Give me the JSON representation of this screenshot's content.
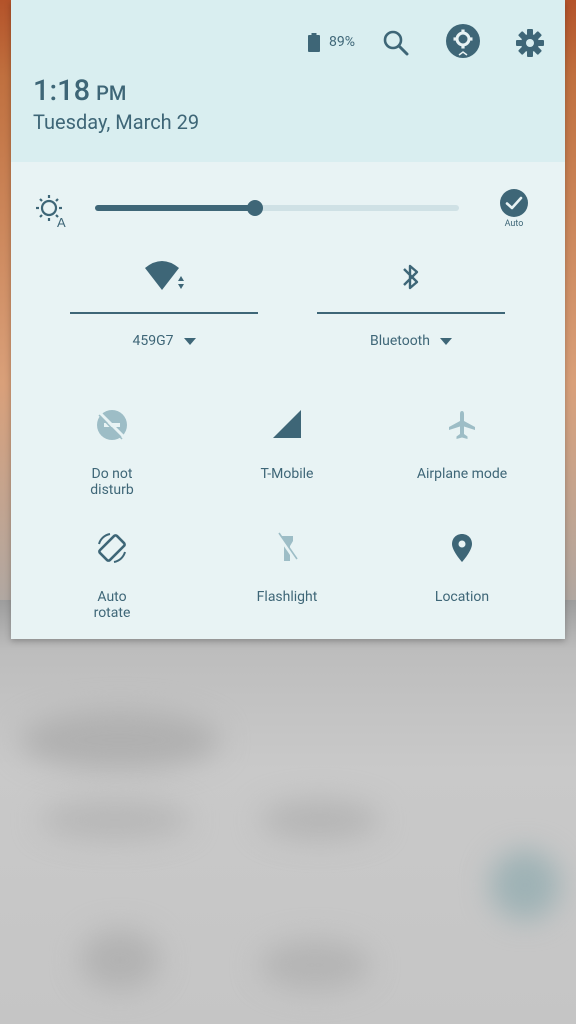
{
  "status": {
    "battery_percent": "89%",
    "time": "1:18",
    "ampm": "PM",
    "date": "Tuesday, March 29"
  },
  "brightness": {
    "level": 0.44,
    "auto_label": "Auto"
  },
  "wifi": {
    "network_name": "459G7"
  },
  "bluetooth": {
    "label": "Bluetooth"
  },
  "tiles": {
    "do_not_disturb": "Do not\ndisturb",
    "t_mobile": "T-Mobile",
    "airplane_mode": "Airplane mode",
    "auto_rotate": "Auto\nrotate",
    "flashlight": "Flashlight",
    "location": "Location"
  },
  "colors": {
    "accent": "#3e6677",
    "disabled": "#9dbdc6",
    "panel": "#e8f3f4",
    "header": "#d9eef0"
  }
}
